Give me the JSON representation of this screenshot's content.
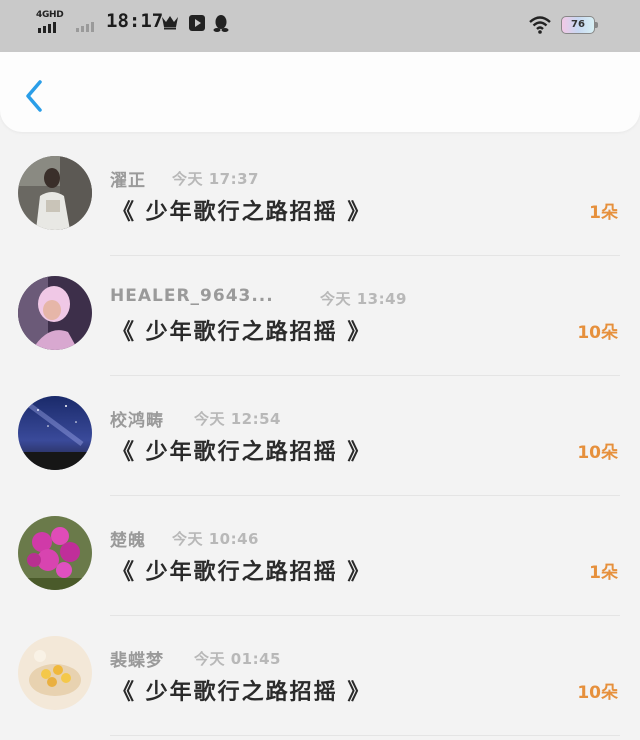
{
  "status_bar": {
    "network": "4GHD",
    "time": "18:17",
    "battery": "76",
    "icons": [
      "signal-bars-icon",
      "signal-bars-weak-icon",
      "crown-icon",
      "video-play-icon",
      "qq-penguin-icon",
      "wifi-icon",
      "battery-icon"
    ]
  },
  "header": {
    "back_icon": "chevron-left-icon"
  },
  "colors": {
    "accent": "#2a9ee8",
    "count": "#e6903c",
    "name": "#9a9a9a",
    "time": "#b8b8b8",
    "title": "#2a2a2a"
  },
  "records": [
    {
      "name": "濯正",
      "time": "今天 17:37",
      "title": "《 少年歌行之路招摇 》",
      "count": "1朵"
    },
    {
      "name": "HEALER_9643...",
      "time": "今天 13:49",
      "title": "《 少年歌行之路招摇 》",
      "count": "10朵"
    },
    {
      "name": "校鸿畴",
      "time": "今天 12:54",
      "title": "《 少年歌行之路招摇 》",
      "count": "10朵"
    },
    {
      "name": "楚魄",
      "time": "今天 10:46",
      "title": "《 少年歌行之路招摇 》",
      "count": "1朵"
    },
    {
      "name": "裴蝶梦",
      "time": "今天 01:45",
      "title": "《 少年歌行之路招摇 》",
      "count": "10朵"
    }
  ]
}
